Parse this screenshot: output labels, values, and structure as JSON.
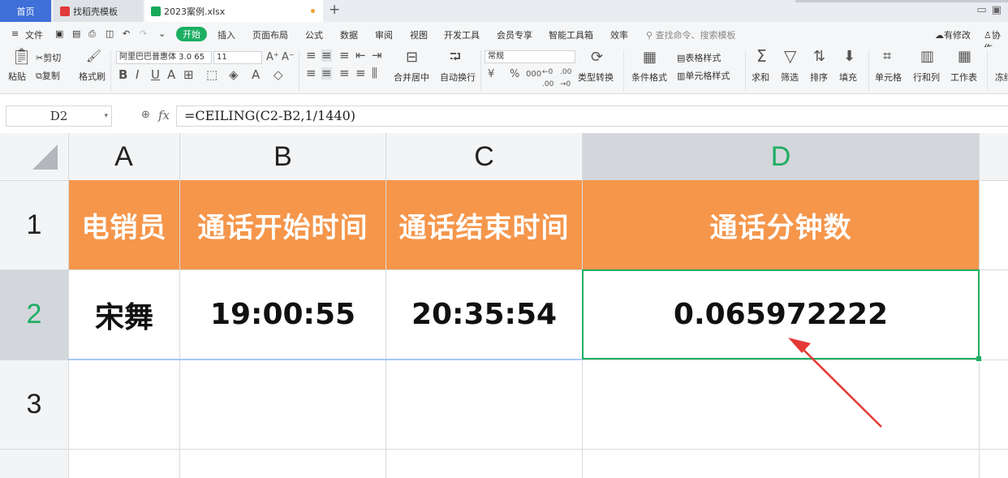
{
  "tabs": {
    "home": "首页",
    "template": "找稻壳模板",
    "file": "2023案例.xlsx",
    "add": "+"
  },
  "menu": {
    "file": "文件",
    "start": "开始",
    "insert": "插入",
    "page_layout": "页面布局",
    "formula": "公式",
    "data": "数据",
    "review": "审阅",
    "view": "视图",
    "dev_tools": "开发工具",
    "member": "会员专享",
    "smart_toolbox": "智能工具箱",
    "efficiency": "效率",
    "search_placeholder": "查找命令、搜索模板",
    "has_changes": "有修改",
    "collab": "协作"
  },
  "ribbon": {
    "paste": "粘贴",
    "cut": "剪切",
    "copy": "复制",
    "format_painter": "格式刷",
    "font_name": "阿里巴巴普惠体 3.0 65",
    "font_size": "11",
    "merge_center": "合并居中",
    "auto_wrap": "自动换行",
    "number_format": "常规",
    "type_convert": "类型转换",
    "conditional_format": "条件格式",
    "table_style": "表格样式",
    "cell_style": "单元格样式",
    "sum": "求和",
    "filter": "筛选",
    "sort": "排序",
    "fill": "填充",
    "cells": "单元格",
    "rows_cols": "行和列",
    "worksheet": "工作表",
    "freeze": "冻结"
  },
  "formula_bar": {
    "name_box": "D2",
    "fx": "fx",
    "formula": "=CEILING(C2-B2,1/1440)"
  },
  "sheet": {
    "columns": [
      "A",
      "B",
      "C",
      "D"
    ],
    "rows": [
      "1",
      "2",
      "3"
    ],
    "header_row": [
      "电销员",
      "通话开始时间",
      "通话结束时间",
      "通话分钟数"
    ],
    "data_row": [
      "宋舞",
      "19:00:55",
      "20:35:54",
      "0.065972222"
    ],
    "selected_cell": "D2"
  },
  "colors": {
    "header_fill": "#f5964b",
    "accent_green": "#1cae62",
    "arrow_red": "#e53935"
  }
}
